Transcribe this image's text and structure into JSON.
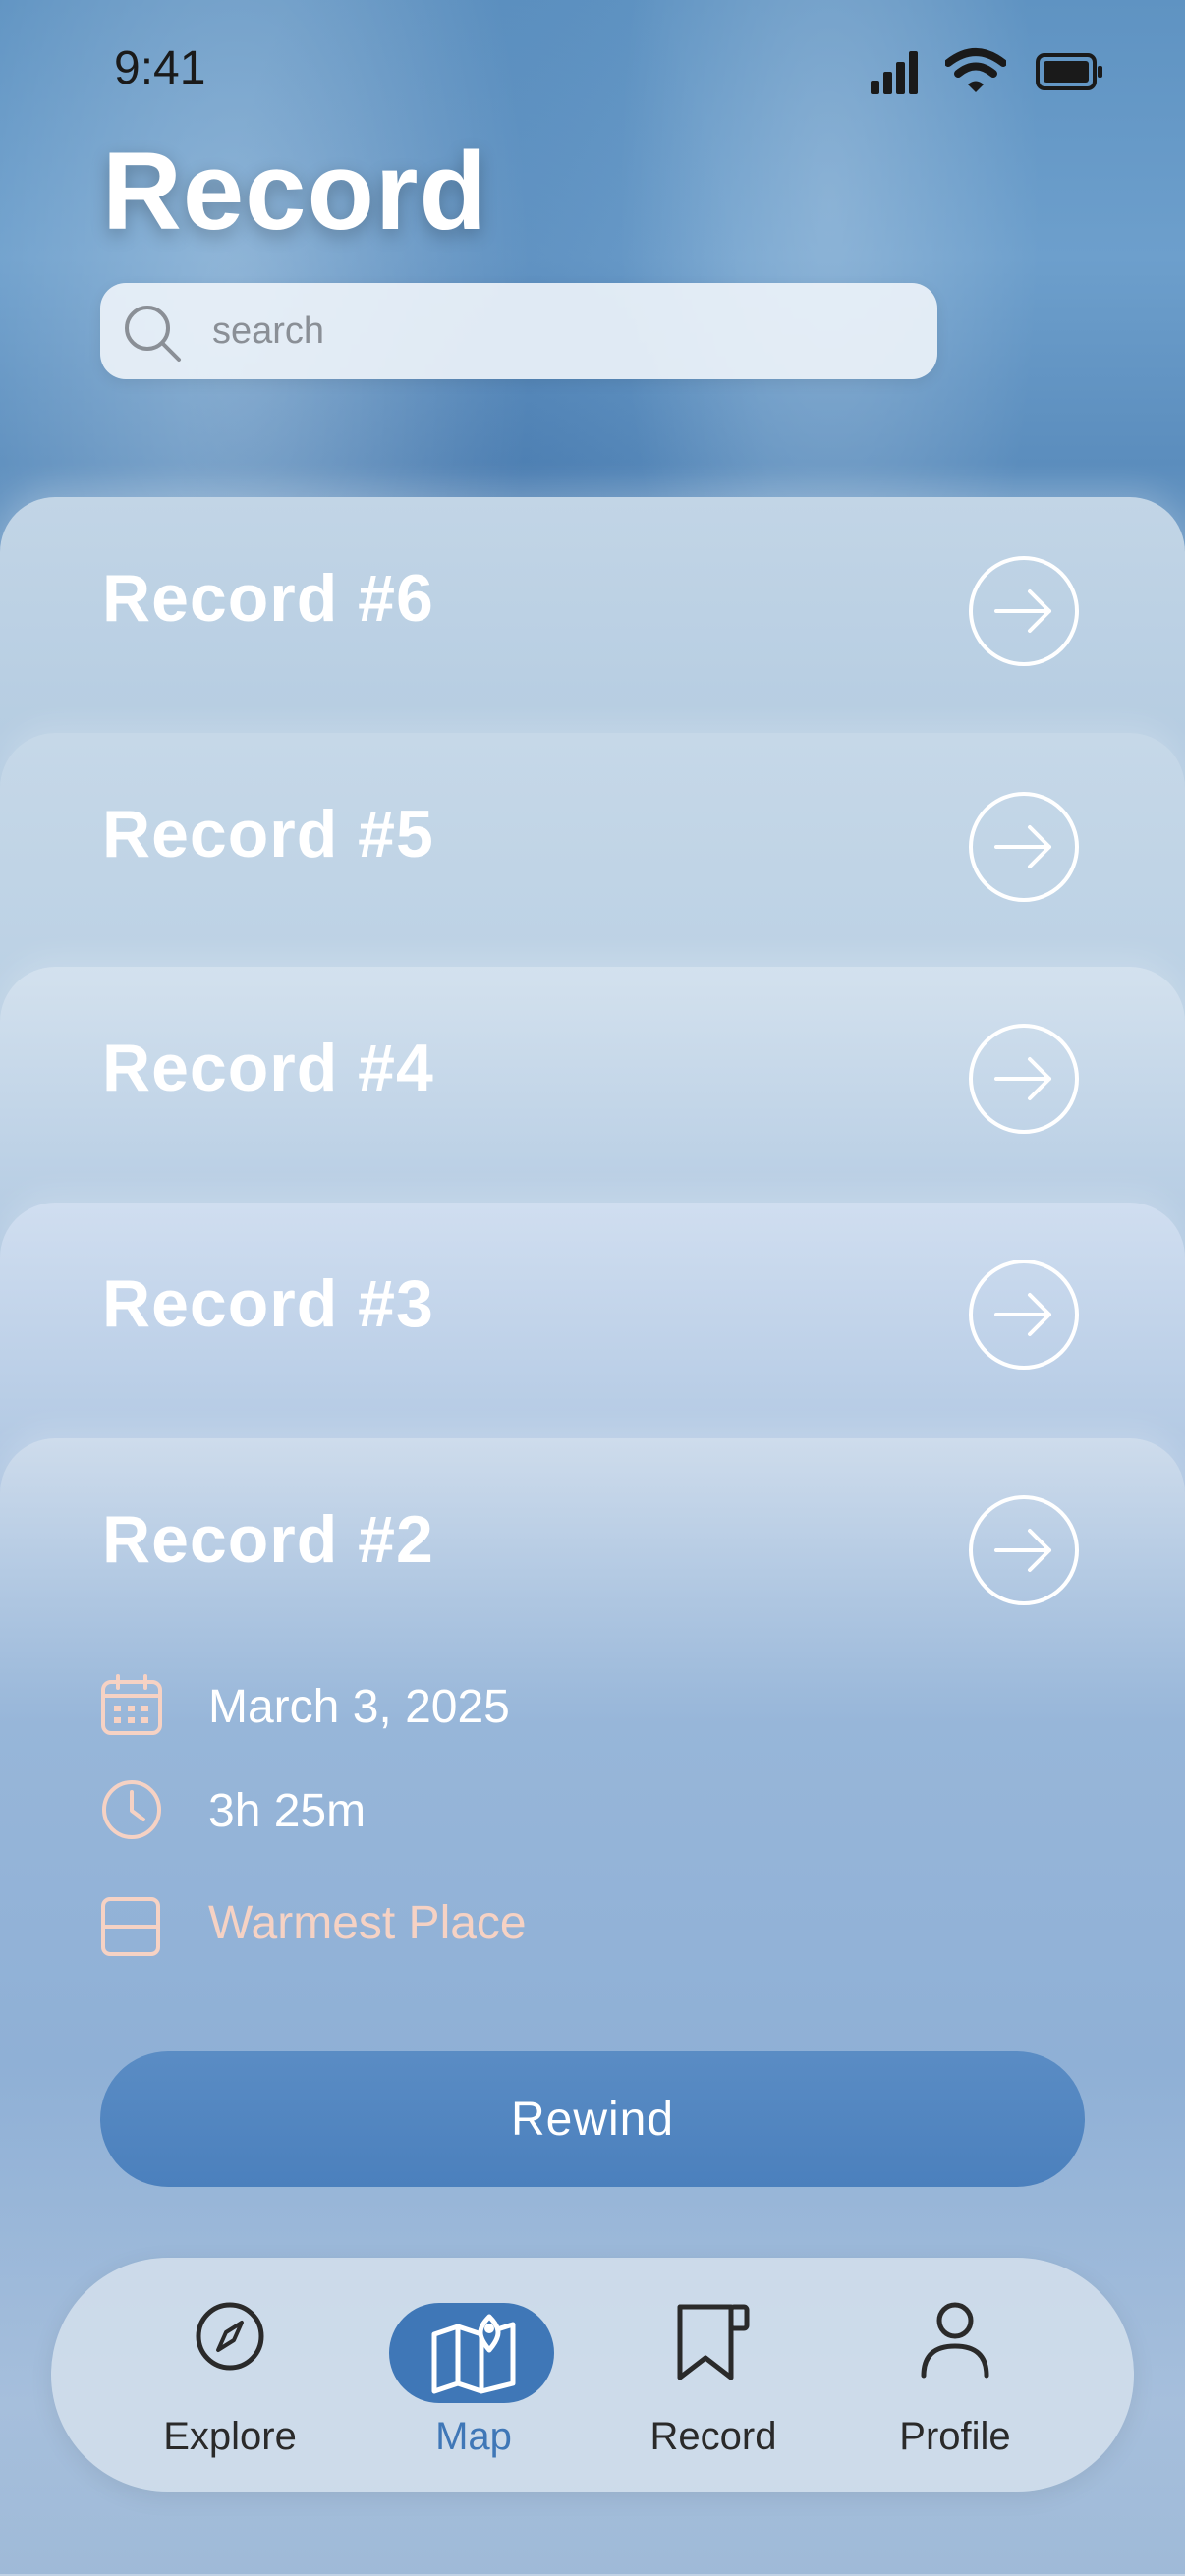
{
  "status_bar": {
    "time": "9:41"
  },
  "header": {
    "title": "Record"
  },
  "search": {
    "placeholder": "search",
    "value": ""
  },
  "records": [
    {
      "title": "Record #6"
    },
    {
      "title": "Record #5"
    },
    {
      "title": "Record #4"
    },
    {
      "title": "Record #3"
    },
    {
      "title": "Record #2",
      "date": "March 3, 2025",
      "duration": "3h 25m",
      "place": "Warmest Place",
      "action_label": "Rewind"
    }
  ],
  "nav": {
    "items": [
      {
        "label": "Explore",
        "icon": "compass-icon",
        "active": false
      },
      {
        "label": "Map",
        "icon": "map-pin-icon",
        "active": true
      },
      {
        "label": "Record",
        "icon": "bookmark-icon",
        "active": false
      },
      {
        "label": "Profile",
        "icon": "person-icon",
        "active": false
      }
    ]
  },
  "colors": {
    "accent": "#3f77b7",
    "detail_icon": "#f6d2c4",
    "button": "#4b80bd"
  }
}
